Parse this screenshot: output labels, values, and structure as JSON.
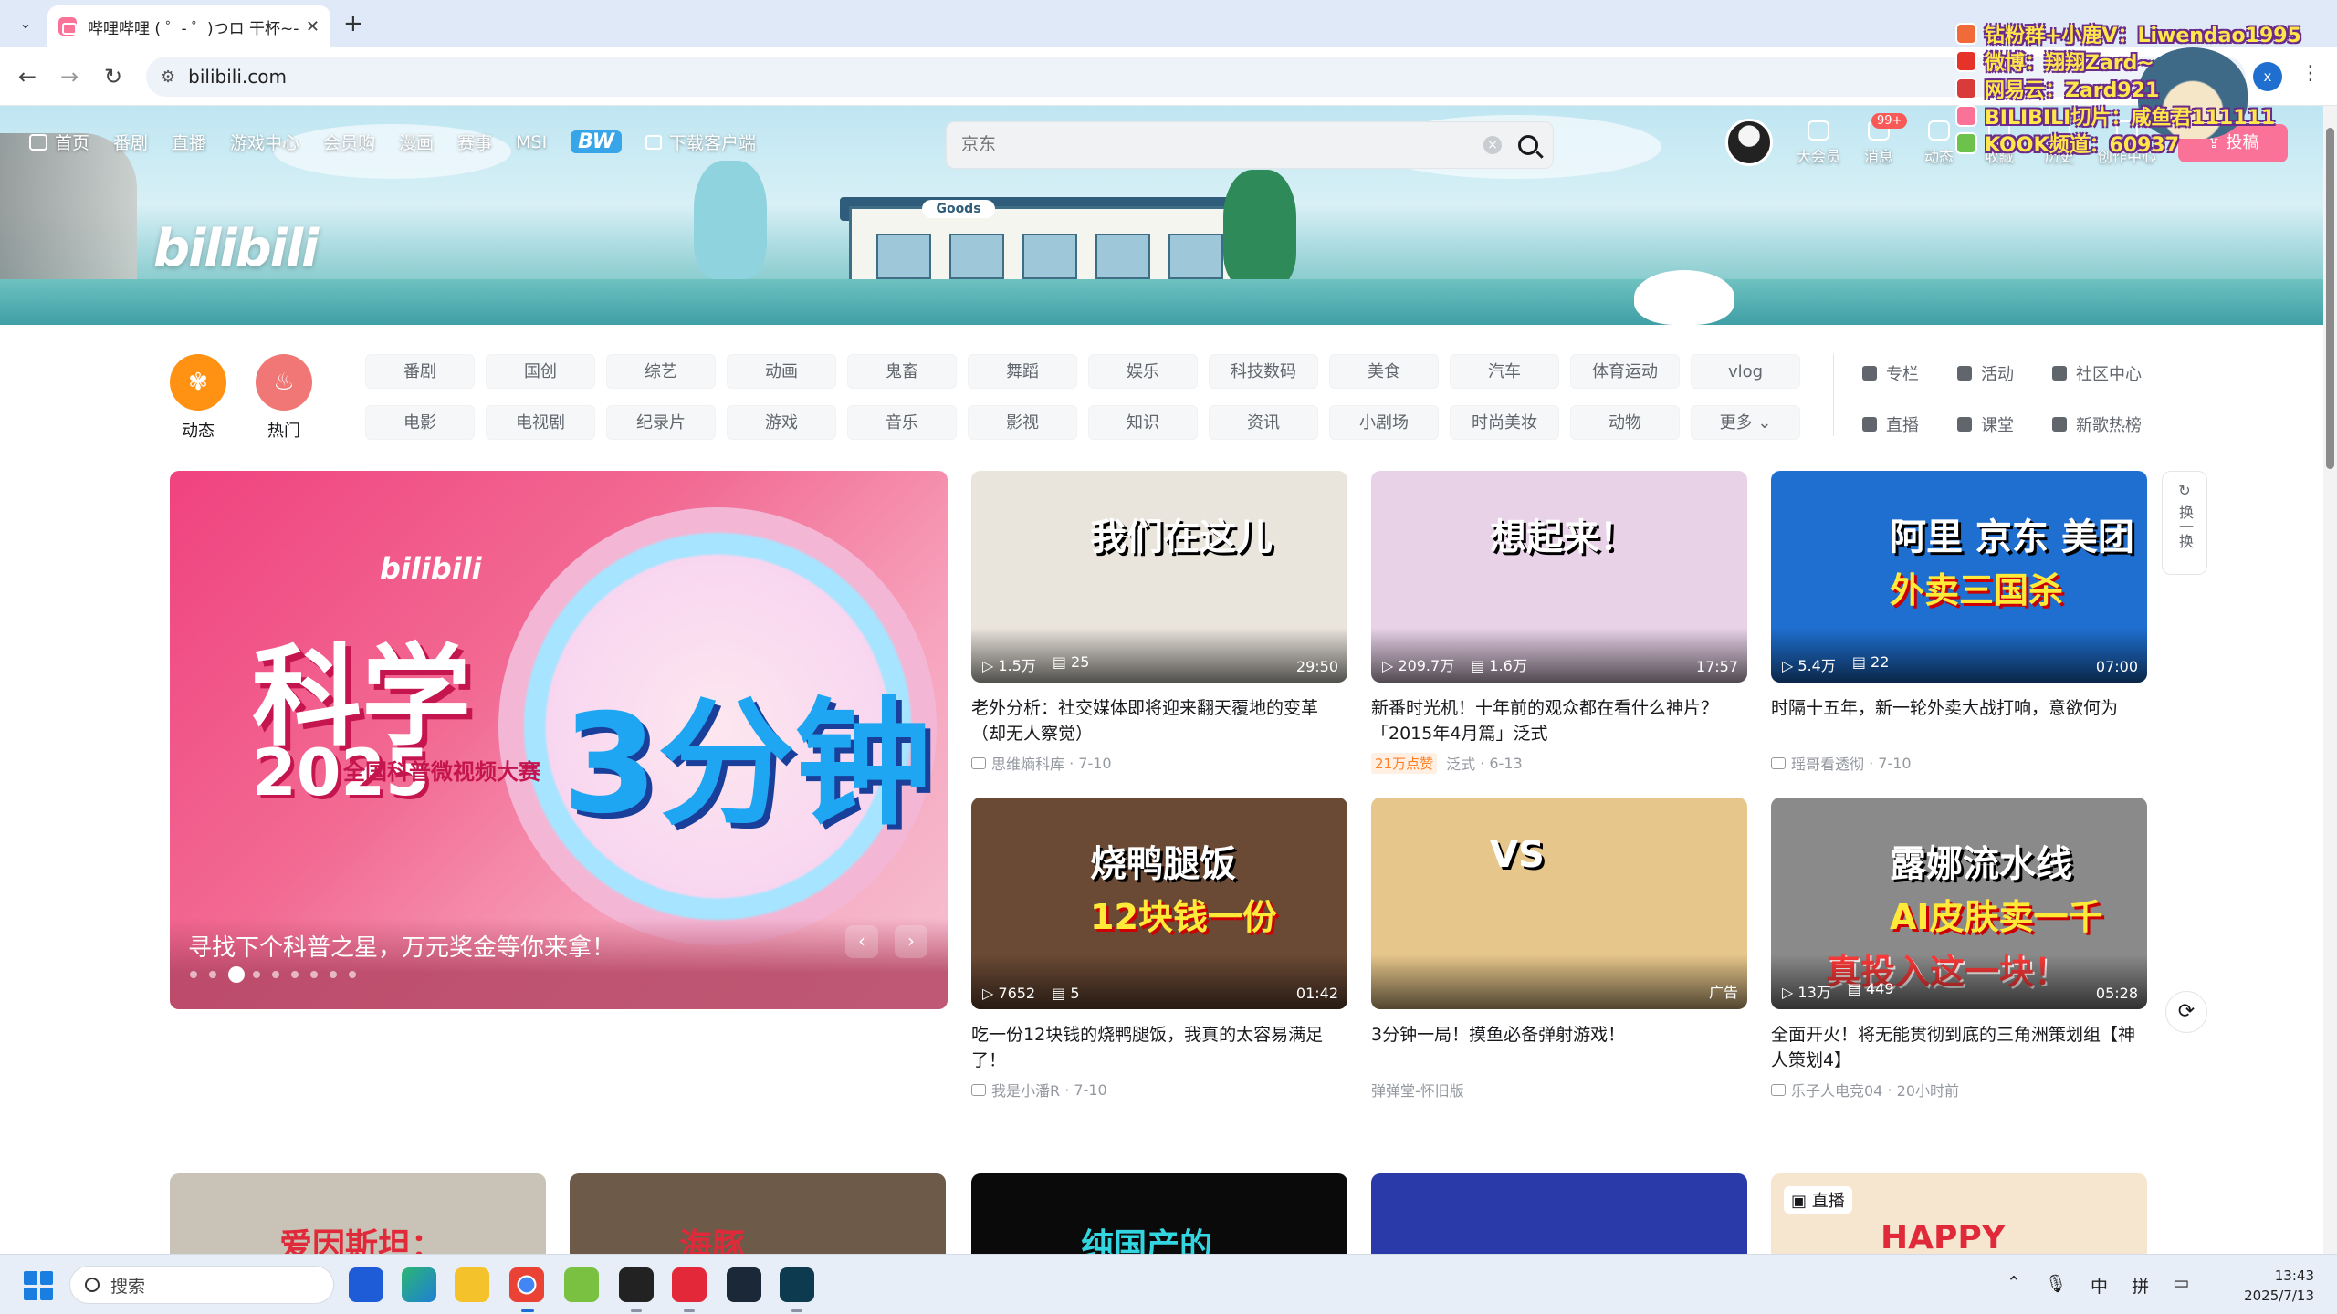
{
  "browser": {
    "tab_title": "哔哩哔哩 ( ゜- ゜)つロ 干杯~-bi",
    "url": "bilibili.com"
  },
  "overlay": {
    "lines": [
      {
        "text": "钻粉群+小鹿V：Liwendao1995",
        "icon_color": "#f06a3a"
      },
      {
        "text": "微博：翔翔Zard~",
        "icon_color": "#e6332a"
      },
      {
        "text": "网易云：Zard921",
        "icon_color": "#d93a3a"
      },
      {
        "text": "BILIBILI切片：咸鱼君111111",
        "icon_color": "#fb7299"
      },
      {
        "text": "KOOK频道：60937",
        "icon_color": "#6cc24a"
      }
    ]
  },
  "header": {
    "nav": [
      "首页",
      "番剧",
      "直播",
      "游戏中心",
      "会员购",
      "漫画",
      "赛事",
      "MSI"
    ],
    "bw_label": "BW",
    "download_label": "下载客户端",
    "search_placeholder": "京东",
    "right": [
      {
        "label": "大会员",
        "icon": "vip-icon"
      },
      {
        "label": "消息",
        "icon": "message-icon"
      },
      {
        "label": "动态",
        "icon": "dynamic-icon"
      },
      {
        "label": "收藏",
        "icon": "favorite-icon"
      },
      {
        "label": "历史",
        "icon": "history-icon"
      },
      {
        "label": "创作中心",
        "icon": "creator-icon"
      }
    ],
    "msg_badge": "99+",
    "upload_label": "投稿",
    "logo": "bilibili"
  },
  "channels": {
    "dynamic_label": "动态",
    "hot_label": "热门",
    "row1": [
      "番剧",
      "国创",
      "综艺",
      "动画",
      "鬼畜",
      "舞蹈",
      "娱乐",
      "科技数码",
      "美食",
      "汽车",
      "体育运动",
      "vlog"
    ],
    "row2": [
      "电影",
      "电视剧",
      "纪录片",
      "游戏",
      "音乐",
      "影视",
      "知识",
      "资讯",
      "小剧场",
      "时尚美妆",
      "动物",
      "更多"
    ],
    "quick": [
      "专栏",
      "活动",
      "社区中心",
      "直播",
      "课堂",
      "新歌热榜"
    ]
  },
  "carousel": {
    "title": "寻找下个科普之星，万元奖金等你来拿！",
    "art_big1": "科学",
    "art_big2": "2025",
    "art_big3": "3分钟",
    "art_sub": "全国科普微视频大赛",
    "art_bili": "bilibili",
    "dots": 9,
    "active_dot": 2
  },
  "refresh_label": "换一换",
  "videos": [
    {
      "title": "老外分析：社交媒体即将迎来翻天覆地的变革（却无人察觉）",
      "views": "1.5万",
      "danmaku": "25",
      "duration": "29:50",
      "up": "思维熵科库",
      "date": "7-10",
      "art": "我们在这儿",
      "bg": "#e9e4dc"
    },
    {
      "title": "新番时光机！十年前的观众都在看什么神片？「2015年4月篇」泛式",
      "views": "209.7万",
      "danmaku": "1.6万",
      "duration": "17:57",
      "up": "泛式",
      "date": "6-13",
      "hot": "21万点赞",
      "art": "想起来！",
      "bg": "#e8d2e8"
    },
    {
      "title": "时隔十五年，新一轮外卖大战打响，意欲何为",
      "views": "5.4万",
      "danmaku": "22",
      "duration": "07:00",
      "up": "瑶哥看透彻",
      "date": "7-10",
      "art": "阿里 京东 美团",
      "art2": "外卖三国杀",
      "bg": "#1e6fd0"
    },
    {
      "title": "吃一份12块钱的烧鸭腿饭，我真的太容易满足了！",
      "views": "7652",
      "danmaku": "5",
      "duration": "01:42",
      "up": "我是小潘R",
      "date": "7-10",
      "art": "烧鸭腿饭",
      "art2": "12块钱一份",
      "bg": "#6b4a35"
    },
    {
      "title": "3分钟一局！摸鱼必备弹射游戏！",
      "views": "",
      "danmaku": "",
      "duration": "广告",
      "up": "弹弹堂-怀旧版",
      "date": "",
      "art": "VS",
      "bg": "#e6c68a",
      "ad": true
    },
    {
      "title": "全面开火！将无能贯彻到底的三角洲策划组【神人策划4】",
      "views": "13万",
      "danmaku": "449",
      "duration": "05:28",
      "up": "乐子人电竞04",
      "date": "20小时前",
      "art": "露娜流水线",
      "art2": "AI皮肤卖一千",
      "art3": "真投入这一块！",
      "bg": "#8a8a8a"
    }
  ],
  "peek_row": [
    {
      "art": "爱因斯坦：",
      "bg": "#c9c2b6"
    },
    {
      "art": "海豚",
      "bg": "#6d5a48"
    },
    {
      "art": "纯国产的",
      "bg": "#0a0a0a"
    },
    {
      "art": "",
      "bg": "#2a3aa8"
    },
    {
      "art": "HAPPY",
      "badge": "直播",
      "bg": "#f6e6d0"
    }
  ],
  "taskbar": {
    "search_label": "搜索",
    "tray": [
      "中",
      "拼"
    ],
    "time": "13:43",
    "date": "2025/7/13"
  }
}
